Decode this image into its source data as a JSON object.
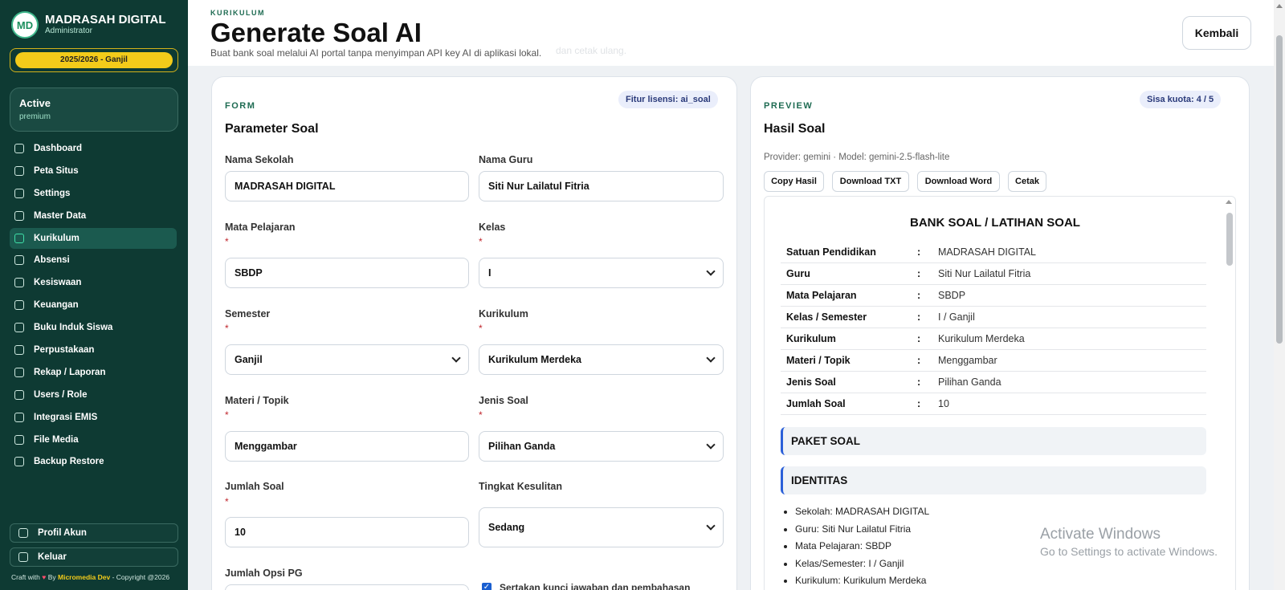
{
  "sidebar": {
    "logo_text": "MD",
    "brand": "MADRASAH DIGITAL",
    "role": "Administrator",
    "year": "2025/2026 - Ganjil",
    "status": {
      "title": "Active",
      "plan": "premium"
    },
    "items": [
      {
        "label": "Dashboard"
      },
      {
        "label": "Peta Situs"
      },
      {
        "label": "Settings"
      },
      {
        "label": "Master Data"
      },
      {
        "label": "Kurikulum",
        "active": true
      },
      {
        "label": "Absensi"
      },
      {
        "label": "Kesiswaan"
      },
      {
        "label": "Keuangan"
      },
      {
        "label": "Buku Induk Siswa"
      },
      {
        "label": "Perpustakaan"
      },
      {
        "label": "Rekap / Laporan"
      },
      {
        "label": "Users / Role"
      },
      {
        "label": "Integrasi EMIS"
      },
      {
        "label": "File Media"
      },
      {
        "label": "Backup Restore"
      }
    ],
    "profile": "Profil Akun",
    "logout": "Keluar",
    "footer": {
      "prefix": "Craft with",
      "heart": "♥",
      "by": "By",
      "dev": "Micromedia Dev",
      "suffix": "- Copyright @2026"
    }
  },
  "header": {
    "kicker": "KURIKULUM",
    "title": "Generate Soal AI",
    "subtitle": "Buat bank soal melalui AI portal tanpa menyimpan API key AI di aplikasi lokal.",
    "ghost_text": "dan cetak ulang.",
    "back_label": "Kembali"
  },
  "form": {
    "section": "FORM",
    "license_badge": "Fitur lisensi: ai_soal",
    "title": "Parameter Soal",
    "required_mark": "*",
    "fields": {
      "nama_sekolah": {
        "label": "Nama Sekolah",
        "value": "MADRASAH DIGITAL"
      },
      "nama_guru": {
        "label": "Nama Guru",
        "value": "Siti Nur Lailatul Fitria"
      },
      "mapel": {
        "label": "Mata Pelajaran",
        "value": "SBDP"
      },
      "kelas": {
        "label": "Kelas",
        "value": "I"
      },
      "semester": {
        "label": "Semester",
        "value": "Ganjil"
      },
      "kurikulum": {
        "label": "Kurikulum",
        "value": "Kurikulum Merdeka"
      },
      "materi": {
        "label": "Materi / Topik",
        "value": "Menggambar"
      },
      "jenis": {
        "label": "Jenis Soal",
        "value": "Pilihan Ganda"
      },
      "jumlah": {
        "label": "Jumlah Soal",
        "value": "10"
      },
      "tingkat": {
        "label": "Tingkat Kesulitan",
        "value": "Sedang"
      },
      "opsi_pg": {
        "label": "Jumlah Opsi PG"
      }
    },
    "checkbox_label": "Sertakan kunci jawaban dan pembahasan",
    "checkbox_checked": true
  },
  "preview": {
    "section": "PREVIEW",
    "quota_badge": "Sisa kuota: 4 / 5",
    "title": "Hasil Soal",
    "provider": "Provider: gemini · Model: gemini-2.5-flash-lite",
    "buttons": {
      "copy": "Copy Hasil",
      "txt": "Download TXT",
      "word": "Download Word",
      "print": "Cetak"
    },
    "doc": {
      "title": "BANK SOAL / LATIHAN SOAL",
      "colon": ":",
      "rows": [
        {
          "key": "Satuan Pendidikan",
          "value": "MADRASAH DIGITAL"
        },
        {
          "key": "Guru",
          "value": "Siti Nur Lailatul Fitria"
        },
        {
          "key": "Mata Pelajaran",
          "value": "SBDP"
        },
        {
          "key": "Kelas / Semester",
          "value": "I / Ganjil"
        },
        {
          "key": "Kurikulum",
          "value": "Kurikulum Merdeka"
        },
        {
          "key": "Materi / Topik",
          "value": "Menggambar"
        },
        {
          "key": "Jenis Soal",
          "value": "Pilihan Ganda"
        },
        {
          "key": "Jumlah Soal",
          "value": "10"
        }
      ],
      "section1": "PAKET SOAL",
      "section2": "IDENTITAS",
      "bullets": [
        "Sekolah: MADRASAH DIGITAL",
        "Guru: Siti Nur Lailatul Fitria",
        "Mata Pelajaran: SBDP",
        "Kelas/Semester: I / Ganjil",
        "Kurikulum: Kurikulum Merdeka"
      ]
    }
  },
  "watermark": {
    "line1": "Activate Windows",
    "line2": "Go to Settings to activate Windows."
  }
}
